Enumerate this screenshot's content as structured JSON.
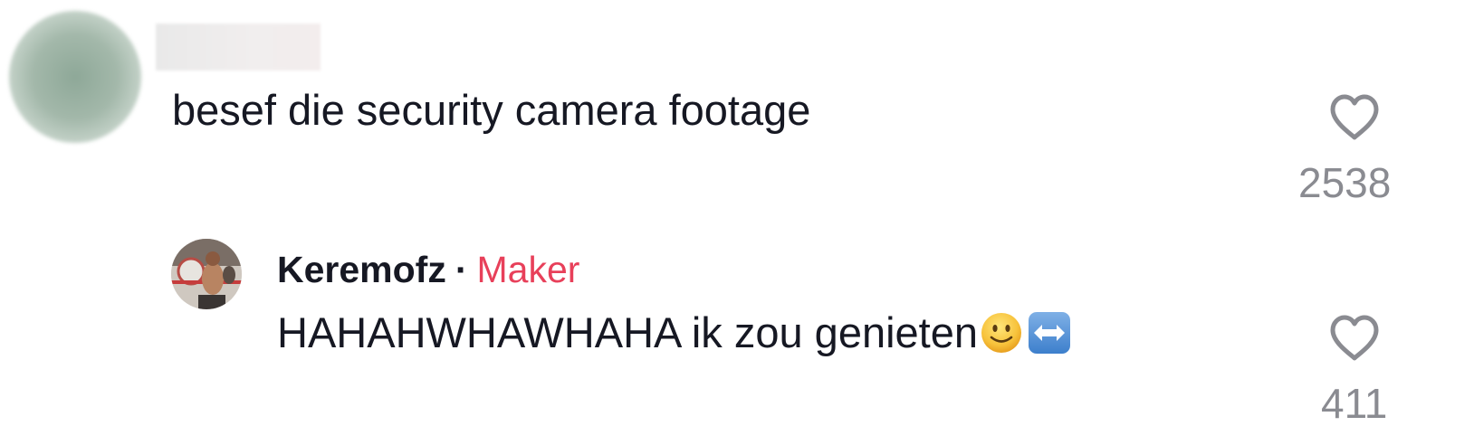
{
  "comment": {
    "username": "",
    "text": "besef die security camera footage",
    "likes": "2538"
  },
  "reply": {
    "username": "Keremofz",
    "separator": "·",
    "badge": "Maker",
    "text": "HAHAHWHAWHAHA ik zou genieten",
    "emojis": [
      "slightly-smiling-face-emoji",
      "left-right-arrow-emoji"
    ],
    "likes": "411"
  },
  "colors": {
    "text": "#161823",
    "muted": "#8a8b91",
    "creator_badge": "#e8405a"
  },
  "icons": {
    "like": "heart-outline-icon"
  }
}
